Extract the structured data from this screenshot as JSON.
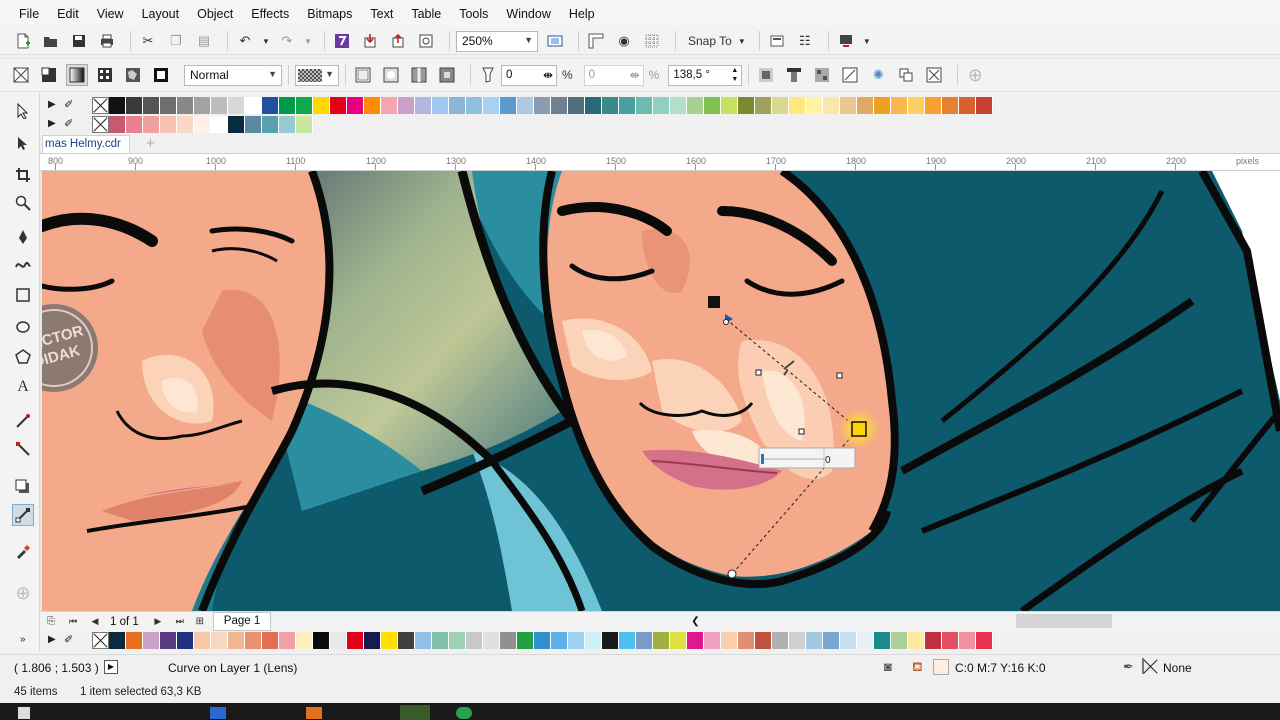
{
  "menu": [
    "File",
    "Edit",
    "View",
    "Layout",
    "Object",
    "Effects",
    "Bitmaps",
    "Text",
    "Table",
    "Tools",
    "Window",
    "Help"
  ],
  "standard_toolbar": {
    "zoom_value": "250%",
    "snap_to_label": "Snap To"
  },
  "property_bar": {
    "merge_mode": "Normal",
    "transparency_value": "0",
    "transparency_unit": "%",
    "transparency_value2": "0",
    "transparency_unit2": "%",
    "angle_value": "138,5 °"
  },
  "document": {
    "tab_name": "mas Helmy.cdr",
    "tab_add": "+"
  },
  "ruler": {
    "ticks": [
      "800",
      "900",
      "1000",
      "1100",
      "1200",
      "1300",
      "1400",
      "1500",
      "1600",
      "1700",
      "1800",
      "1900",
      "2000",
      "2100",
      "2200"
    ],
    "unit": "pixels"
  },
  "page_nav": {
    "page_counter": "1 of 1",
    "page_tab": "Page 1"
  },
  "status": {
    "coordinates": "( 1.806 ; 1.503 )",
    "object_info": "Curve on Layer 1  (Lens)",
    "fill_info": "C:0 M:7 Y:16 K:0",
    "outline_info": "None"
  },
  "info": {
    "items_count": "45 items",
    "selection": "1 item selected  63,3 KB"
  },
  "transparency_handle": {
    "value": "0"
  },
  "watermark": {
    "text_line1": "VECTOR",
    "text_line2": "DIDAK"
  },
  "palette_top": [
    "#111111",
    "#3a3a3a",
    "#555555",
    "#6e6e6e",
    "#888888",
    "#a2a2a2",
    "#bdbdbd",
    "#d8d8d8",
    "#ffffff",
    "#2050a0",
    "#009a48",
    "#12a84a",
    "#ffd800",
    "#e2001a",
    "#e6007e",
    "#ff8c00",
    "#f4a6b0",
    "#c8a0c8",
    "#b0b8e0",
    "#a0c8f0",
    "#8cb4d8",
    "#90c0e0",
    "#a8d0f0",
    "#5a9ad0",
    "#b0c8e0",
    "#8c9cb0",
    "#708090",
    "#507080",
    "#2a6a78",
    "#3a8a8a",
    "#4aa0a0",
    "#6abcb0",
    "#90d0c0",
    "#b0e0c8",
    "#a8d090",
    "#80c050",
    "#c8e060",
    "#7a8a30",
    "#a0a060",
    "#d8d890",
    "#ffe880",
    "#fff4a0",
    "#f8e8b0",
    "#e8c890",
    "#e0a860",
    "#f0a020",
    "#f8b850",
    "#ffd060",
    "#f8a030",
    "#e88030",
    "#d86030",
    "#c84030"
  ],
  "palette_top2": [
    "#c85a70",
    "#e88090",
    "#f0a0a0",
    "#f8c0b0",
    "#fad8c8",
    "#fff0e8",
    "#ffffff",
    "#0a2a40",
    "#5a8aa0",
    "#58a0b0",
    "#98c8d0",
    "#c8e8a0"
  ],
  "palette_bottom": [
    "#0a2a40",
    "#e87020",
    "#c8a0c8",
    "#5a3a80",
    "#203080",
    "#f8c8a8",
    "#f8d8c0",
    "#f0b890",
    "#e89070",
    "#e07050",
    "#f0a0a8",
    "#fff0c0",
    "#0a0a0a",
    "#e8e8e8",
    "#e0001a",
    "#1a1a50",
    "#ffe000",
    "#404040",
    "#90c0e8",
    "#80c0a8",
    "#a0d0b8",
    "#c8c8c8",
    "#e0e0e0",
    "#909090",
    "#20a040",
    "#3090d0",
    "#60b0e8",
    "#a0d0f0",
    "#d0f0f8",
    "#1a1a1a",
    "#50c0f0",
    "#7a9ac8",
    "#a0b040",
    "#e0e040",
    "#e01890",
    "#f0a0c0",
    "#f8d0b0",
    "#e09070",
    "#c05040",
    "#b0b0b0",
    "#d0d0d0",
    "#a0c8e0",
    "#78a8d0",
    "#c8e0f0",
    "#e8f0f8",
    "#1a8a8a",
    "#a8d098",
    "#ffe8a0",
    "#c03040",
    "#e05060",
    "#f090a0",
    "#e83050"
  ],
  "canvas_colors": {
    "teal": "#0d5a6c",
    "teal_mid": "#2a8ea0",
    "teal_light": "#6ec4d4",
    "skin": "#f4a98a",
    "skin_light": "#fbd3b8",
    "skin_highlight": "#fde7d3",
    "skin_shadow": "#e0826a",
    "lips": "#d4708a",
    "outline": "#0a0a0a"
  }
}
